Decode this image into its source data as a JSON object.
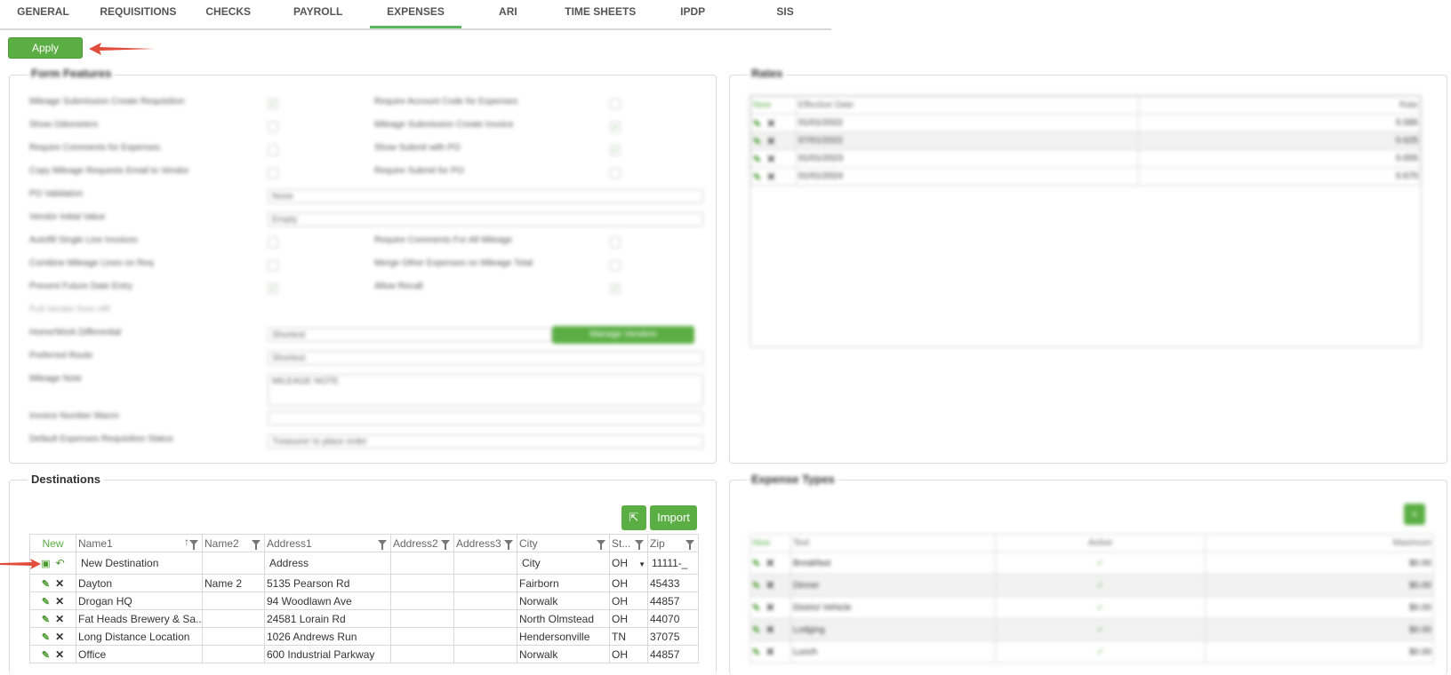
{
  "tabs": [
    {
      "label": "GENERAL"
    },
    {
      "label": "REQUISITIONS"
    },
    {
      "label": "CHECKS"
    },
    {
      "label": "PAYROLL"
    },
    {
      "label": "EXPENSES",
      "active": true
    },
    {
      "label": "ARI"
    },
    {
      "label": "TIME SHEETS"
    },
    {
      "label": "IPDP"
    },
    {
      "label": "SIS"
    }
  ],
  "apply_label": "Apply",
  "form_features": {
    "legend": "Form Features",
    "rows": [
      {
        "label": "Mileage Submission Create Requisition",
        "right": "Require Account Code for Expenses"
      },
      {
        "label": "Show Odometers",
        "right": "Mileage Submission Create Invoice"
      },
      {
        "label": "Require Comments for Expenses",
        "right": "Show Submit with PO"
      },
      {
        "label": "Copy Mileage Requests Email to Vendor",
        "right": "Require Submit for PO"
      },
      {
        "label": "PO Validation",
        "select": "None"
      },
      {
        "label": "Vendor Initial Value",
        "select": "Empty"
      },
      {
        "label": "Autofill Single Line Invoices",
        "right": "Require Comments For All Mileage"
      },
      {
        "label": "Combine Mileage Lines on Req",
        "right": "Merge Other Expenses on Mileage Total"
      },
      {
        "label": "Prevent Future Date Entry",
        "right": "Allow Recall"
      },
      {
        "label": "Pull Vendor from HR"
      },
      {
        "label": "Home/Work Differential",
        "select": "Shortest",
        "button": "Manage Vendors"
      },
      {
        "label": "Preferred Route",
        "select": "Shortest"
      },
      {
        "label": "Mileage Note",
        "textarea": "MILEAGE NOTE"
      },
      {
        "label": "Invoice Number Macro"
      },
      {
        "label": "Default Expenses Requisition Status",
        "select": "Treasurer to place order"
      }
    ]
  },
  "rates": {
    "legend": "Rates",
    "header": {
      "new": "New",
      "date": "Effective Date",
      "rate": "Rate"
    },
    "rows": [
      {
        "date": "01/01/2022",
        "rate": "0.585"
      },
      {
        "date": "07/01/2022",
        "rate": "0.625"
      },
      {
        "date": "01/01/2023",
        "rate": "0.655"
      },
      {
        "date": "01/01/2024",
        "rate": "0.670"
      }
    ]
  },
  "destinations": {
    "legend": "Destinations",
    "import_label": "Import",
    "columns": [
      "New",
      "Name1",
      "Name2",
      "Address1",
      "Address2",
      "Address3",
      "City",
      "St...",
      "Zip"
    ],
    "new_row": {
      "name1": "New Destination",
      "address1": "Address",
      "city": "City",
      "state": "OH",
      "zip": "11111-_"
    },
    "rows": [
      {
        "name1": "Dayton",
        "name2": "Name 2",
        "address1": "5135 Pearson Rd",
        "city": "Fairborn",
        "state": "OH",
        "zip": "45433"
      },
      {
        "name1": "Drogan HQ",
        "name2": "",
        "address1": "94 Woodlawn Ave",
        "city": "Norwalk",
        "state": "OH",
        "zip": "44857"
      },
      {
        "name1": "Fat Heads Brewery & Sa...",
        "name2": "",
        "address1": "24581 Lorain Rd",
        "city": "North Olmstead",
        "state": "OH",
        "zip": "44070"
      },
      {
        "name1": "Long Distance Location",
        "name2": "",
        "address1": "1026 Andrews Run",
        "city": "Hendersonville",
        "state": "TN",
        "zip": "37075"
      },
      {
        "name1": "Office",
        "name2": "",
        "address1": "600 Industrial Parkway",
        "city": "Norwalk",
        "state": "OH",
        "zip": "44857"
      }
    ]
  },
  "expense_types": {
    "legend": "Expense Types",
    "header": {
      "new": "New",
      "text": "Text",
      "active": "Active",
      "max": "Maximum"
    },
    "rows": [
      {
        "text": "Breakfast",
        "max": "$0.00"
      },
      {
        "text": "Dinner",
        "max": "$0.00"
      },
      {
        "text": "District Vehicle",
        "max": "$0.00"
      },
      {
        "text": "Lodging",
        "max": "$0.00"
      },
      {
        "text": "Lunch",
        "max": "$0.00"
      }
    ]
  },
  "colors": {
    "accent": "#5aae43",
    "arrow": "#e24c3c"
  }
}
